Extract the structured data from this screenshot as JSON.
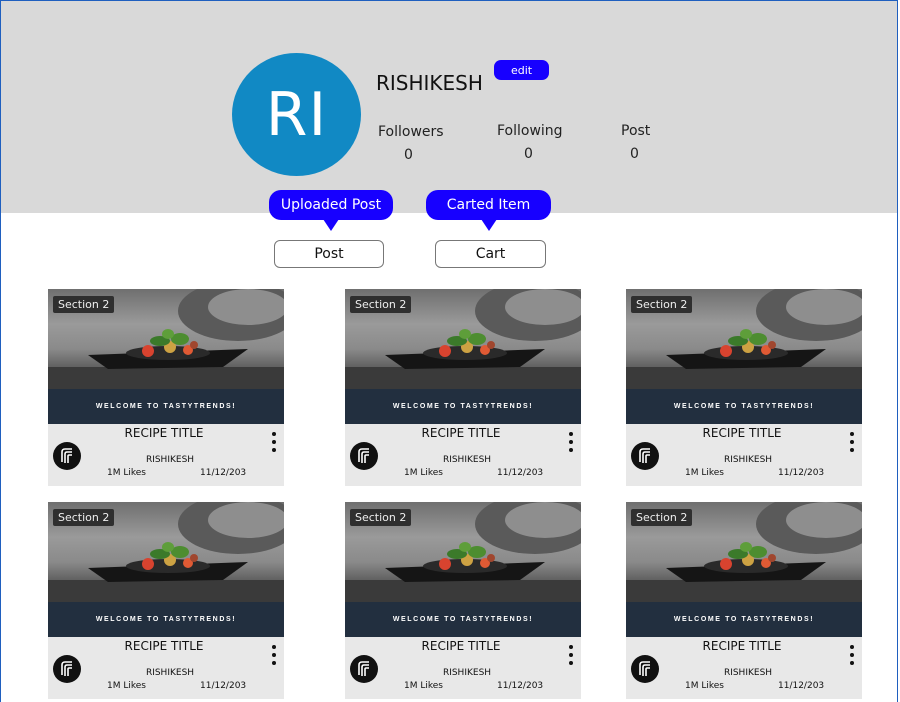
{
  "profile": {
    "avatar_initials": "RI",
    "username": "RISHIKESH",
    "edit_label": "edit",
    "stats": [
      {
        "label": "Followers",
        "value": "0"
      },
      {
        "label": "Following",
        "value": "0"
      },
      {
        "label": "Post",
        "value": "0"
      }
    ]
  },
  "tabs": {
    "post_tooltip": "Uploaded Post",
    "post_label": "Post",
    "cart_tooltip": "Carted Item",
    "cart_label": "Cart"
  },
  "cards": [
    {
      "badge": "Section 2",
      "banner": "WELCOME TO TASTYTRENDS!",
      "title": "RECIPE TITLE",
      "author": "RISHIKESH",
      "likes": "1M Likes",
      "date": "11/12/203"
    },
    {
      "badge": "Section 2",
      "banner": "WELCOME TO TASTYTRENDS!",
      "title": "RECIPE TITLE",
      "author": "RISHIKESH",
      "likes": "1M Likes",
      "date": "11/12/203"
    },
    {
      "badge": "Section 2",
      "banner": "WELCOME TO TASTYTRENDS!",
      "title": "RECIPE TITLE",
      "author": "RISHIKESH",
      "likes": "1M Likes",
      "date": "11/12/203"
    },
    {
      "badge": "Section 2",
      "banner": "WELCOME TO TASTYTRENDS!",
      "title": "RECIPE TITLE",
      "author": "RISHIKESH",
      "likes": "1M Likes",
      "date": "11/12/203"
    },
    {
      "badge": "Section 2",
      "banner": "WELCOME TO TASTYTRENDS!",
      "title": "RECIPE TITLE",
      "author": "RISHIKESH",
      "likes": "1M Likes",
      "date": "11/12/203"
    },
    {
      "badge": "Section 2",
      "banner": "WELCOME TO TASTYTRENDS!",
      "title": "RECIPE TITLE",
      "author": "RISHIKESH",
      "likes": "1M Likes",
      "date": "11/12/203"
    }
  ],
  "colors": {
    "accent": "#1700ff",
    "avatar": "#1189c4",
    "header_bg": "#d9d9d9",
    "banner_bg": "#222f3f"
  },
  "icons": {
    "card_logo": "brand-logo-icon",
    "card_menu": "kebab-menu-icon"
  }
}
